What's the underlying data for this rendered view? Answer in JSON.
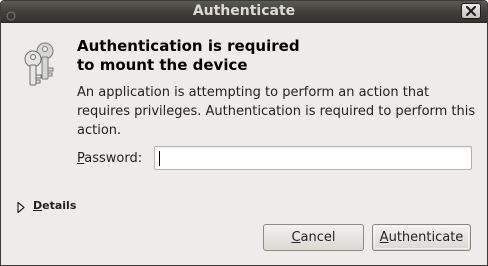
{
  "window": {
    "title": "Authenticate"
  },
  "dialog": {
    "heading_line1": "Authentication is required",
    "heading_line2": "to mount the device",
    "message": "An application is attempting to perform an action that requires privileges. Authentication is required to perform this action.",
    "password_label_mnemonic": "P",
    "password_label_rest": "assword:",
    "password_value": "",
    "details_mnemonic": "D",
    "details_rest": "etails",
    "cancel_mnemonic": "C",
    "cancel_rest": "ancel",
    "authenticate_mnemonic": "A",
    "authenticate_rest": "uthenticate"
  },
  "icons": {
    "dialog_icon": "keys-icon",
    "close": "close-icon",
    "window_menu": "window-menu-icon",
    "details_expander": "triangle-right-icon"
  },
  "colors": {
    "titlebar": "#3f3e3a",
    "dialog_bg": "#edeceb",
    "title_text": "#dfdbd2"
  }
}
